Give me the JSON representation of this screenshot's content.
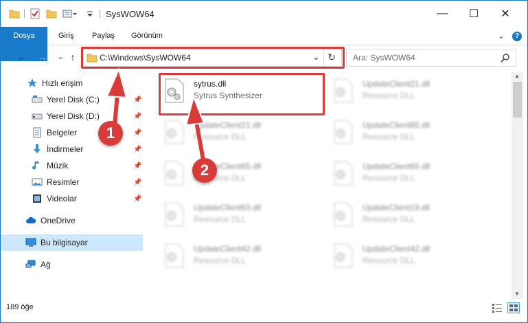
{
  "window": {
    "title": "SysWOW64",
    "minimize_label": "—",
    "maximize_label": "☐",
    "close_label": "✕"
  },
  "ribbon": {
    "tabs": [
      {
        "label": "Dosya",
        "active": true
      },
      {
        "label": "Giriş"
      },
      {
        "label": "Paylaş"
      },
      {
        "label": "Görünüm"
      }
    ],
    "expand_label": "⌄",
    "help_label": "?"
  },
  "nav": {
    "back_label": "←",
    "forward_label": "→",
    "recent_label": "⌄",
    "up_label": "↑"
  },
  "address": {
    "path": "C:\\Windows\\SysWOW64",
    "dropdown_label": "⌄",
    "refresh_label": "↻"
  },
  "search": {
    "placeholder": "Ara: SysWOW64",
    "icon": "search-icon"
  },
  "sidebar": {
    "items": [
      {
        "label": "Hızlı erişim",
        "icon": "star-icon",
        "pinned": false
      },
      {
        "label": "Yerel Disk (C:)",
        "icon": "drive-icon",
        "pinned": true
      },
      {
        "label": "Yerel Disk (D:)",
        "icon": "drive-icon",
        "pinned": true
      },
      {
        "label": "Belgeler",
        "icon": "documents-icon",
        "pinned": true
      },
      {
        "label": "İndirmeler",
        "icon": "download-icon",
        "pinned": true
      },
      {
        "label": "Müzik",
        "icon": "music-icon",
        "pinned": true
      },
      {
        "label": "Resimler",
        "icon": "pictures-icon",
        "pinned": true
      },
      {
        "label": "Videolar",
        "icon": "video-icon",
        "pinned": true
      },
      {
        "label": "OneDrive",
        "icon": "cloud-icon",
        "pinned": false
      },
      {
        "label": "Bu bilgisayar",
        "icon": "computer-icon",
        "pinned": false,
        "selected": true
      },
      {
        "label": "Ağ",
        "icon": "network-icon",
        "pinned": false
      }
    ],
    "pin_glyph": "📌"
  },
  "files": [
    {
      "name": "sytrus.dll",
      "description": "Sytrus Synthesizer",
      "highlighted": true
    },
    {
      "name": "UpdateClient21.dll",
      "description": "Resource DLL"
    },
    {
      "name": "UpdateClient21.dll",
      "description": "Resource DLL"
    },
    {
      "name": "UpdateClient65.dll",
      "description": "Resource DLL"
    },
    {
      "name": "UpdateClient65.dll",
      "description": "Resource DLL"
    },
    {
      "name": "UpdateClient65.dll",
      "description": "Resource DLL"
    },
    {
      "name": "UpdateClient63.dll",
      "description": "Resource DLL"
    },
    {
      "name": "UpdateClient19.dll",
      "description": "Resource DLL"
    },
    {
      "name": "UpdateClient42.dll",
      "description": "Resource DLL"
    },
    {
      "name": "UpdateClient42.dll",
      "description": "Resource DLL"
    }
  ],
  "status": {
    "item_count": "189 öğe"
  },
  "callouts": [
    {
      "number": "1"
    },
    {
      "number": "2"
    }
  ],
  "colors": {
    "accent": "#1979ca",
    "callout_red": "#d93a3a",
    "selected_bg": "#cce8ff"
  }
}
